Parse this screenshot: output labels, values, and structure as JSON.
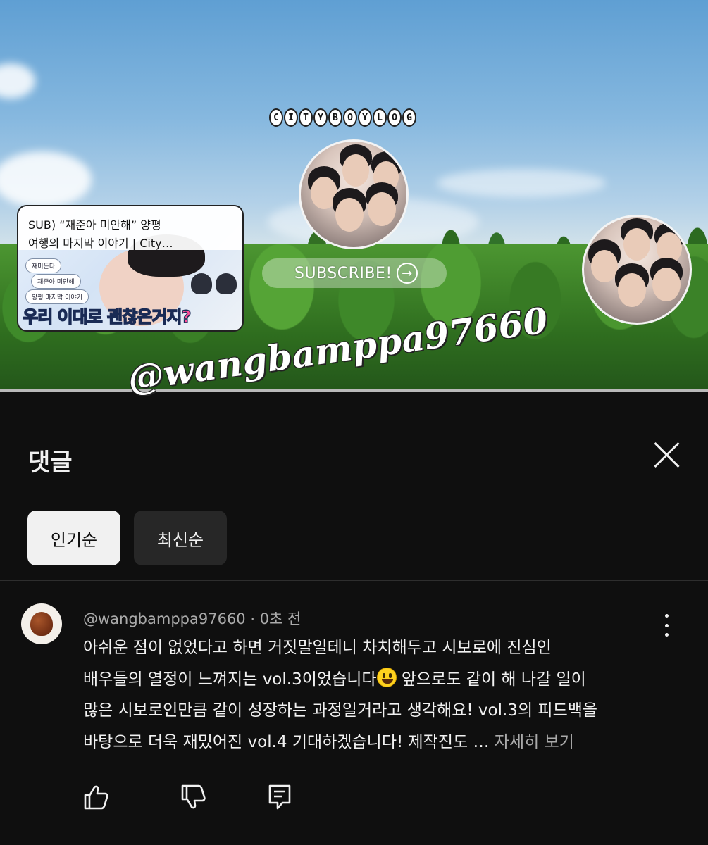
{
  "banner": {
    "logo_letters": [
      "C",
      "I",
      "T",
      "Y",
      "B",
      "O",
      "Y",
      "L",
      "O",
      "G"
    ],
    "video_title_line1": "SUB) “재준아 미안해” 양평",
    "video_title_line2": "여행의 마지막 이야기 | City…",
    "video_bubbles": [
      "재미든다",
      "재준아 미안해",
      "양평 마지막 이야기"
    ],
    "video_caption": "우리 이대로 괜찮은거지?",
    "subscribe_label": "SUBSCRIBE!",
    "subscribe_arrow": "→"
  },
  "watermark": "@wangbamppa97660",
  "sheet": {
    "title": "댓글",
    "close_icon": "close-icon",
    "chips": [
      "인기순",
      "최신순"
    ],
    "selected_chip": "인기순"
  },
  "comment": {
    "author": "@wangbamppa97660",
    "separator": " · ",
    "time": "0초 전",
    "lines": [
      "아쉬운 점이 없었다고 하면 거짓말일테니 차치해두고 시보로에 진심인",
      "배우들의 열정이 느껴지는 vol.3이었습니다",
      " 앞으로도 같이 해 나갈 일이",
      "많은 시보로인만큼 같이 성장하는 과정일거라고 생각해요! vol.3의 피드백을",
      "바탕으로 더욱 재밌어진 vol.4 기대하겠습니다! 제작진도 … "
    ],
    "more_label": "자세히 보기",
    "emoji": "smiling-face-emoji"
  },
  "actions": {
    "like_icon": "thumbs-up-icon",
    "dislike_icon": "thumbs-down-icon",
    "reply_icon": "reply-icon"
  },
  "colors": {
    "sheet_bg": "#0f0f0f",
    "chip_selected_bg": "#f1f1f1",
    "chip_bg": "#272727",
    "secondary_text": "#aaaaaa"
  }
}
